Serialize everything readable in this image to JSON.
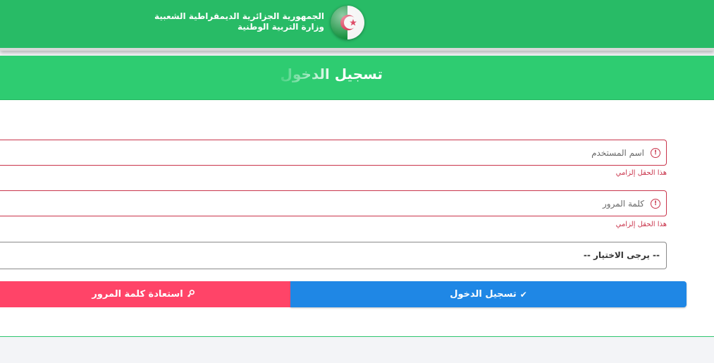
{
  "header": {
    "line1": "الجمهورية الجزائرية الديمقراطية الشعبية",
    "line2": "وزارة التربية الوطنية",
    "emblem_icon": "algeria-flag-emblem-icon"
  },
  "card": {
    "title": "تسجيل الدخول"
  },
  "form": {
    "username": {
      "value": "",
      "placeholder": "اسم المستخدم",
      "error": "هذا الحقل إلزامي",
      "icon": "error-circle-icon"
    },
    "password": {
      "value": "",
      "placeholder": "كلمة المرور",
      "error": "هذا الحقل إلزامي",
      "icon": "error-circle-icon"
    },
    "select": {
      "selected": "-- يرجى الاختيار --"
    }
  },
  "buttons": {
    "login_label": "تسجيل الدخول",
    "login_icon": "checkmark-icon",
    "recover_label": "استعادة كلمة المرور",
    "recover_icon": "key-icon"
  },
  "colors": {
    "header_green": "#28bb66",
    "card_header_green": "#2ecc71",
    "error_red": "#c9344b",
    "login_blue": "#1f87e5",
    "recover_pink": "#ff4468"
  }
}
